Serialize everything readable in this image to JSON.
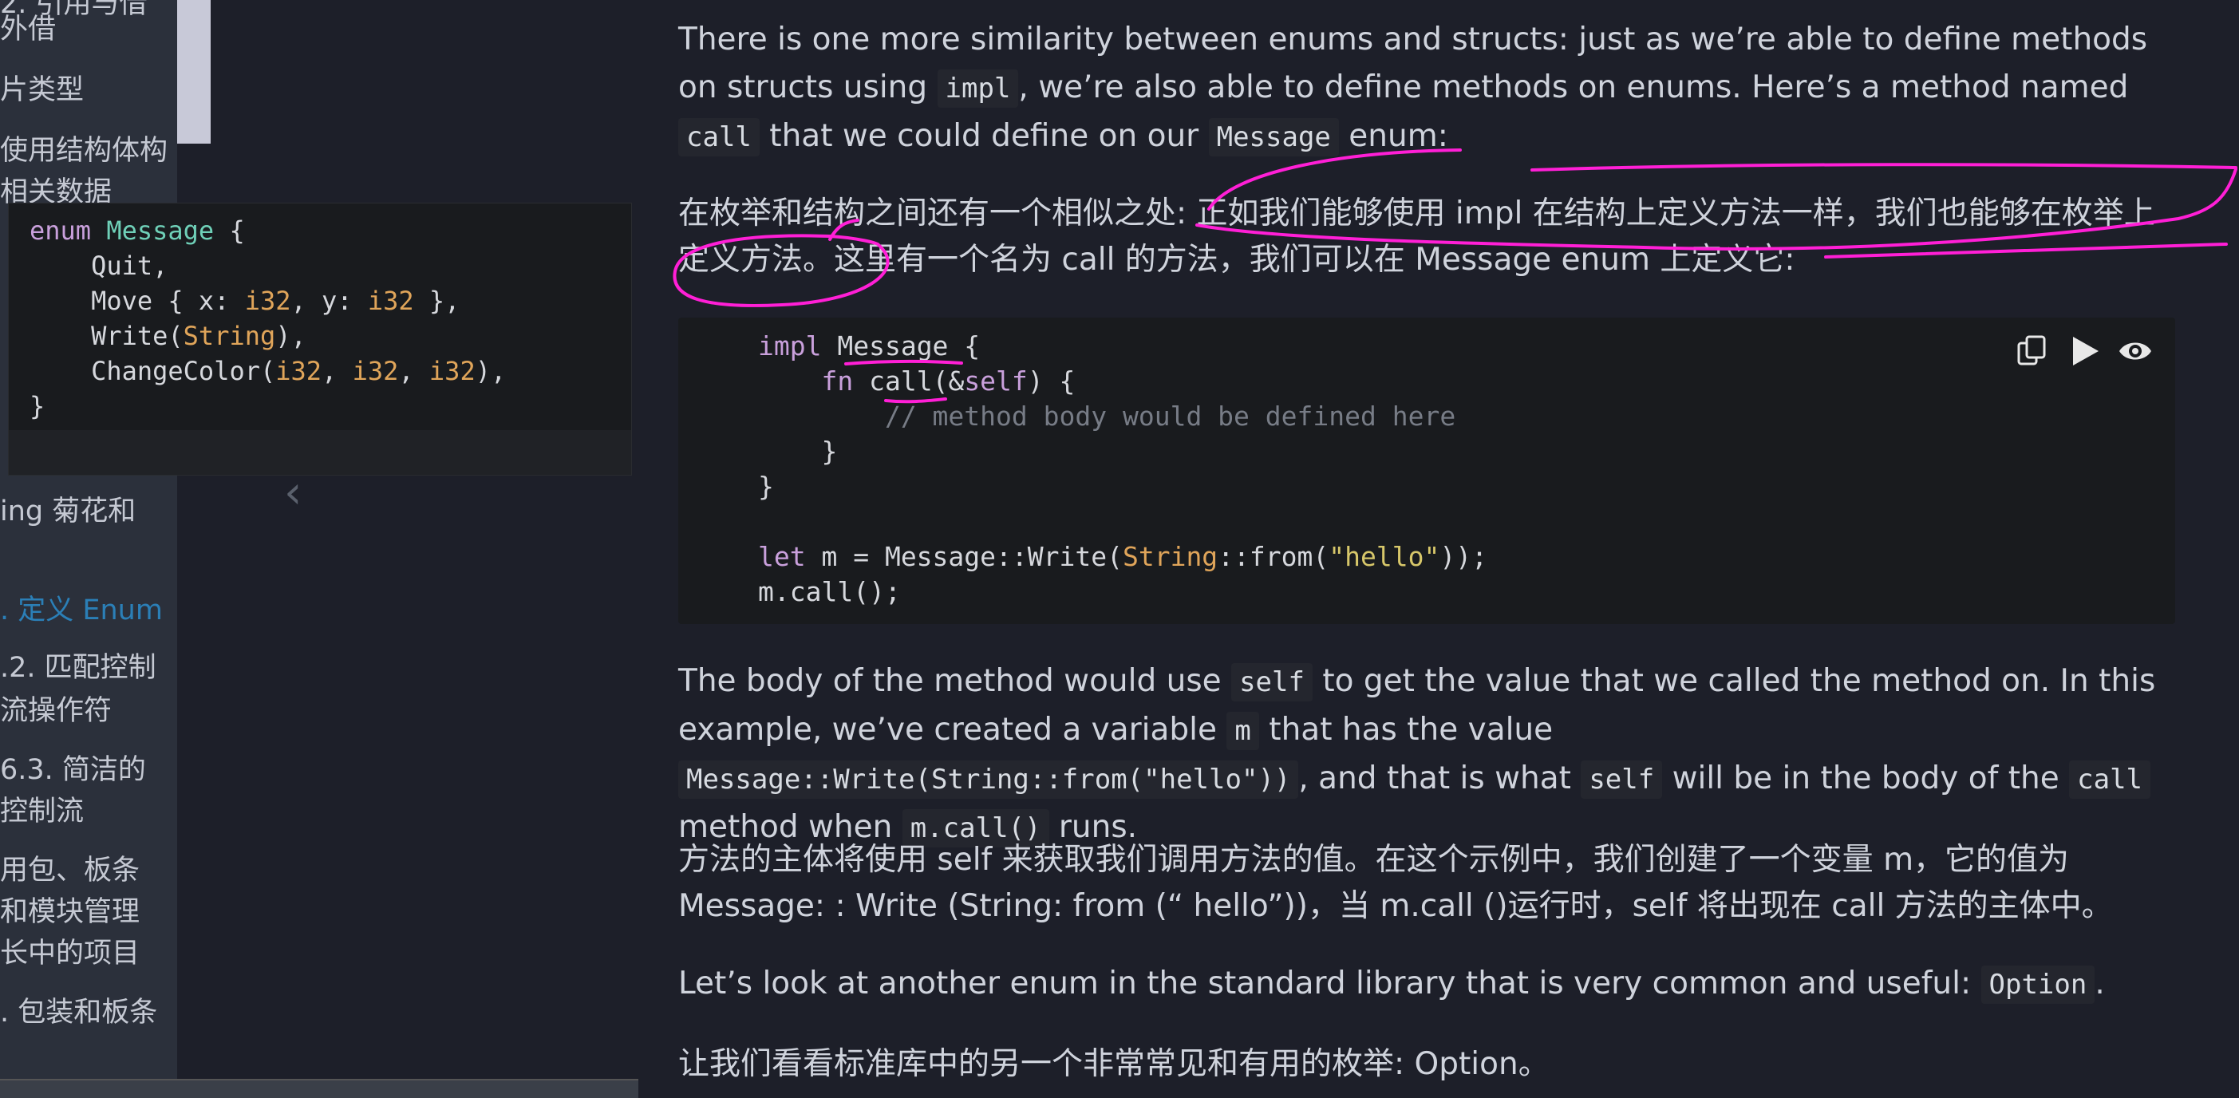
{
  "sidebar": {
    "items": [
      {
        "label": "2. 引用与借",
        "active": false
      },
      {
        "label": "外借",
        "active": false
      },
      {
        "label": "片类型",
        "active": false
      },
      {
        "label": "使用结构体构",
        "active": false
      },
      {
        "label": "相关数据",
        "active": false
      },
      {
        "label": "ing 菊花和",
        "active": false
      },
      {
        "label": ". 定义 Enum",
        "active": true
      },
      {
        "label": ".2. 匹配控制",
        "active": false
      },
      {
        "label": "流操作符",
        "active": false
      },
      {
        "label": "6.3. 简洁的",
        "active": false
      },
      {
        "label": "控制流",
        "active": false
      },
      {
        "label": "用包、板条",
        "active": false
      },
      {
        "label": "和模块管理",
        "active": false
      },
      {
        "label": "长中的项目",
        "active": false
      },
      {
        "label": ". 包装和板条",
        "active": false
      }
    ]
  },
  "popup": {
    "lines": [
      "enum Message {",
      "    Quit,",
      "    Move { x: i32, y: i32 },",
      "    Write(String),",
      "    ChangeColor(i32, i32, i32),",
      "}"
    ]
  },
  "content": {
    "p1": {
      "t1": "There is one more similarity between enums and structs: just as we’re able to define methods on structs using ",
      "c1": "impl",
      "t2": ", we’re also able to define methods on enums. Here’s a method named ",
      "c2": "call",
      "t3": " that we could define on our ",
      "c3": "Message",
      "t4": " enum:"
    },
    "p2": "在枚举和结构之间还有一个相似之处: 正如我们能够使用 impl 在结构上定义方法一样，我们也能够在枚举上定义方法。这里有一个名为 call 的方法，我们可以在 Message enum 上定义它:",
    "code": {
      "lines": [
        "impl Message {",
        "    fn call(&self) {",
        "        // method body would be defined here",
        "    }",
        "}",
        "",
        "let m = Message::Write(String::from(\"hello\"));",
        "m.call();"
      ]
    },
    "p3": {
      "t1": "The body of the method would use ",
      "c1": "self",
      "t2": " to get the value that we called the method on. In this example, we’ve created a variable ",
      "c2": "m",
      "t3": " that has the value ",
      "c3": "Message::Write(String::from(\"hello\"))",
      "t4": ", and that is what ",
      "c4": "self",
      "t5": " will be in the body of the ",
      "c5": "call",
      "t6": " method when ",
      "c6": "m.call()",
      "t7": " runs."
    },
    "p4": "方法的主体将使用 self 来获取我们调用方法的值。在这个示例中，我们创建了一个变量 m，它的值为 Message: : Write (String: from (“ hello”))，当 m.call ()运行时，self 将出现在 call 方法的主体中。",
    "p5": {
      "t1": "Let’s look at another enum in the standard library that is very common and useful: ",
      "c1": "Option",
      "t2": "."
    },
    "p6": "让我们看看标准库中的另一个非常常见和有用的枚举: Option。"
  },
  "icons": {
    "copy": "copy-icon",
    "play": "play-icon",
    "toggle": "eye-icon",
    "prev": "chevron-left-icon"
  },
  "colors": {
    "background": "#1d1f29",
    "sidebar": "#2b303b",
    "active_link": "#2b7fb7",
    "annotation": "#ff1fd6"
  }
}
